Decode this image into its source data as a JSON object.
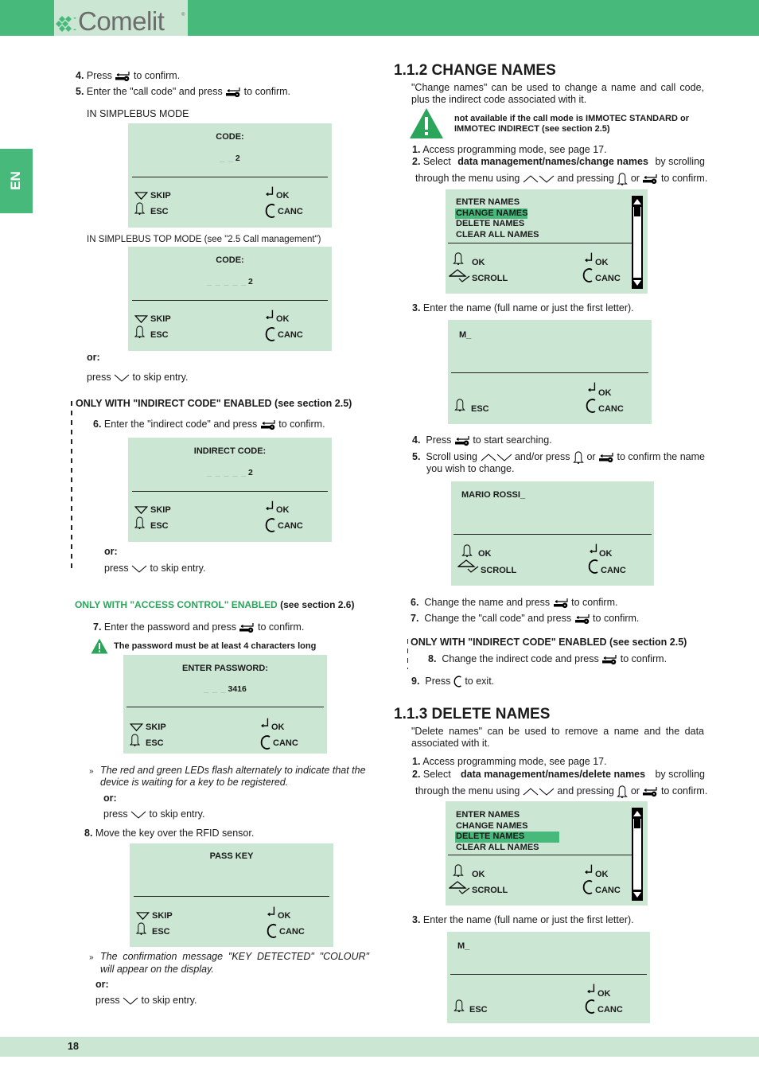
{
  "header": {
    "logo_text": "Comelit",
    "logo_reg": "®"
  },
  "lang_tab": "EN",
  "page_number": "18",
  "colors": {
    "brand_green": "#46b97b",
    "lcd_bg": "#cbe6d3",
    "highlight": "#46b97b"
  },
  "left": {
    "step4": {
      "num": "4.",
      "pre": "Press",
      "post": "to confirm."
    },
    "step5": {
      "num": "5.",
      "pre": "Enter the \"call code\" and press",
      "post": "to confirm."
    },
    "mode1_label": "IN SIMPLEBUS MODE",
    "lcd1": {
      "title": "CODE:",
      "dashes": "_ _",
      "value": "2",
      "skip": "SKIP",
      "esc": "ESC",
      "ok": "OK",
      "canc": "CANC"
    },
    "mode2_label": "IN SIMPLEBUS TOP MODE (see \"2.5 Call management\")",
    "lcd2": {
      "title": "CODE:",
      "dashes": "_ _ _  _ _",
      "value": "2",
      "skip": "SKIP",
      "esc": "ESC",
      "ok": "OK",
      "canc": "CANC"
    },
    "or1": "or:",
    "press1": {
      "pre": "press",
      "post": "to skip entry."
    },
    "indirect_heading": "ONLY WITH \"INDIRECT CODE\" ENABLED (see section 2.5)",
    "step6": {
      "num": "6.",
      "pre": "Enter the \"indirect code\" and press",
      "post": "to confirm."
    },
    "lcd3": {
      "title": "INDIRECT CODE:",
      "dashes": "_ _ _ _ _",
      "value": "2",
      "skip": "SKIP",
      "esc": "ESC",
      "ok": "OK",
      "canc": "CANC"
    },
    "or2": "or:",
    "press2": {
      "pre": "press",
      "post": "to skip entry."
    },
    "access_heading_green": "ONLY WITH \"ACCESS CONTROL\" ENABLED",
    "access_heading_rest": "(see section 2.6)",
    "step7": {
      "num": "7.",
      "pre": "Enter the password and press",
      "post": "to confirm."
    },
    "warning_pw": "The password must be at least 4 characters long",
    "lcd4": {
      "title": "ENTER PASSWORD:",
      "dashes": "_ _ _",
      "value": "3416",
      "skip": "SKIP",
      "esc": "ESC",
      "ok": "OK",
      "canc": "CANC"
    },
    "note1_line1": "The red and green LEDs flash alternately to indicate that the",
    "note1_line2": "device is waiting for a key to be registered.",
    "bullet": "»",
    "or3": "or:",
    "press3": {
      "pre": "press",
      "post": "to skip entry."
    },
    "step8": {
      "num": "8.",
      "text": "Move the key over the RFID sensor."
    },
    "lcd5": {
      "title": "PASS KEY",
      "skip": "SKIP",
      "esc": "ESC",
      "ok": "OK",
      "canc": "CANC"
    },
    "note2_line1": "The confirmation message \"KEY DETECTED\" \"COLOUR\"",
    "note2_line2": "will appear on the display.",
    "or4": "or:",
    "press4": {
      "pre": "press",
      "post": "to skip entry."
    }
  },
  "right": {
    "change": {
      "heading": "1.1.2 CHANGE NAMES",
      "intro1": "\"Change names\" can be used to change a name and call code,",
      "intro2": "plus the indirect code associated with it.",
      "warning1": "not available if the call mode is IMMOTEC STANDARD or",
      "warning2": "IMMOTEC INDIRECT (see section 2.5)",
      "step1": {
        "num": "1.",
        "text": "Access programming mode, see page 17."
      },
      "step2": {
        "num": "2.",
        "pre": "Select",
        "bold": "data management/names/change names",
        "post": "by scrolling"
      },
      "step2b": {
        "pre": "through the menu using",
        "mid": "and pressing",
        "or": "or",
        "post": "to confirm."
      },
      "menu_lcd": {
        "items": [
          "ENTER NAMES",
          "CHANGE NAMES",
          "DELETE NAMES",
          "CLEAR ALL NAMES"
        ],
        "selected_index": 1,
        "ok1": "OK",
        "scroll": "SCROLL",
        "ok2": "OK",
        "canc": "CANC"
      },
      "step3": {
        "num": "3.",
        "text": "Enter the name (full name or just the first letter)."
      },
      "name_lcd": {
        "value": "M_",
        "esc": "ESC",
        "ok": "OK",
        "canc": "CANC"
      },
      "step4": {
        "num": "4.",
        "pre": "Press",
        "post": "to start searching."
      },
      "step5": {
        "num": "5.",
        "pre": "Scroll using",
        "mid": "and/or press",
        "or": "or",
        "post": "to confirm the name",
        "line2": "you wish to change."
      },
      "result_lcd": {
        "value": "MARIO ROSSI_",
        "ok1": "OK",
        "scroll": "SCROLL",
        "ok2": "OK",
        "canc": "CANC"
      },
      "step6": {
        "num": "6.",
        "pre": "Change the name and press",
        "post": "to confirm."
      },
      "step7": {
        "num": "7.",
        "pre": "Change the \"call code\" and press",
        "post": "to confirm."
      },
      "indirect_heading": "ONLY WITH \"INDIRECT CODE\" ENABLED (see section 2.5)",
      "step8": {
        "num": "8.",
        "pre": "Change the indirect code and press",
        "post": "to confirm."
      },
      "step9": {
        "num": "9.",
        "pre": "Press",
        "post": "to exit."
      }
    },
    "delete": {
      "heading": "1.1.3 DELETE NAMES",
      "intro1": "\"Delete names\" can be used to remove a name and the data",
      "intro2": "associated with it.",
      "step1": {
        "num": "1.",
        "text": "Access programming mode, see page 17."
      },
      "step2": {
        "num": "2.",
        "pre": "Select",
        "bold": "data management/names/delete names",
        "post": "by scrolling"
      },
      "step2b": {
        "pre": "through the menu using",
        "mid": "and pressing",
        "or": "or",
        "post": "to confirm."
      },
      "menu_lcd": {
        "items": [
          "ENTER NAMES",
          "CHANGE NAMES",
          "DELETE NAMES",
          "CLEAR ALL NAMES"
        ],
        "selected_index": 2,
        "ok1": "OK",
        "scroll": "SCROLL",
        "ok2": "OK",
        "canc": "CANC"
      },
      "step3": {
        "num": "3.",
        "text": "Enter the name (full name or just the first letter)."
      },
      "name_lcd": {
        "value": "M_",
        "esc": "ESC",
        "ok": "OK",
        "canc": "CANC"
      }
    }
  }
}
